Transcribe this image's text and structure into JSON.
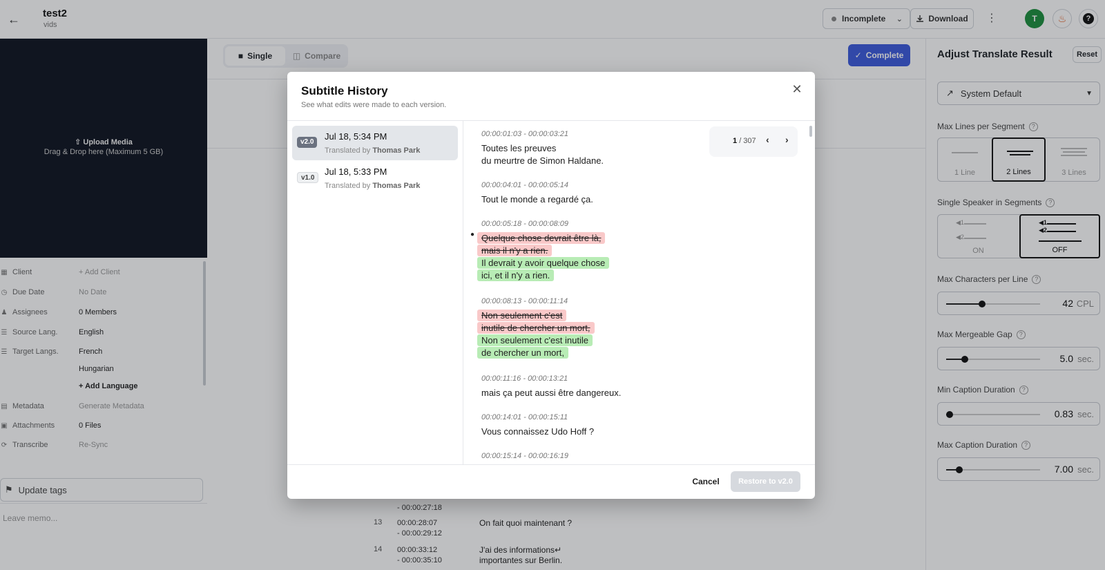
{
  "header": {
    "title": "test2",
    "subtitle": "vids",
    "status_label": "Incomplete",
    "download_label": "Download",
    "avatar_initial": "T"
  },
  "left": {
    "upload_title": "Upload Media",
    "upload_hint": "Drag & Drop here (Maximum 5 GB)",
    "info": [
      {
        "key": "Client",
        "value": "Add Client"
      },
      {
        "key": "Due Date",
        "value": "No Date"
      },
      {
        "key": "Assignees",
        "value": "0 Members"
      },
      {
        "key": "Source Lang.",
        "value": "English"
      },
      {
        "key": "Target Langs.",
        "value": "French"
      },
      {
        "key": "",
        "value": "Hungarian"
      },
      {
        "key": "",
        "value": "+ Add Language"
      },
      {
        "key": "Metadata",
        "value": "Generate Metadata"
      },
      {
        "key": "Attachments",
        "value": "0 Files"
      },
      {
        "key": "Transcribe",
        "value": "Re-Sync"
      }
    ],
    "tags_placeholder": "Update tags",
    "memo_placeholder": "Leave memo..."
  },
  "center": {
    "mode_single": "Single",
    "mode_compare": "Compare",
    "complete_label": "Complete",
    "rows": [
      {
        "num": "",
        "time_start": "",
        "time_end": "- 00:00:27:18",
        "text1": "",
        "text2": ""
      },
      {
        "num": "13",
        "time_start": "00:00:28:07",
        "time_end": "- 00:00:29:12",
        "text1": "On fait quoi maintenant ?",
        "text2": ""
      },
      {
        "num": "14",
        "time_start": "00:00:33:12",
        "time_end": "- 00:00:35:10",
        "text1": "J'ai des informations↵",
        "text2": "importantes sur Berlin."
      }
    ]
  },
  "right": {
    "title": "Adjust Translate Result",
    "reset_label": "Reset",
    "preset": "System Default",
    "max_lines_label": "Max Lines per Segment",
    "lines_options": [
      "1 Line",
      "2 Lines",
      "3 Lines"
    ],
    "lines_selected": 1,
    "speaker_label": "Single Speaker in Segments",
    "speaker_options": [
      "ON",
      "OFF"
    ],
    "speaker_selected": 1,
    "sliders": [
      {
        "label": "Max Characters per Line",
        "value": "42",
        "unit": "CPL",
        "fraction": 0.38
      },
      {
        "label": "Max Mergeable Gap",
        "value": "5.0",
        "unit": "sec.",
        "fraction": 0.2
      },
      {
        "label": "Min Caption Duration",
        "value": "0.83",
        "unit": "sec.",
        "fraction": 0.04
      },
      {
        "label": "Max Caption Duration",
        "value": "7.00",
        "unit": "sec.",
        "fraction": 0.14
      }
    ]
  },
  "modal": {
    "title": "Subtitle History",
    "subtitle": "See what edits were made to each version.",
    "versions": [
      {
        "badge": "v2.0",
        "date": "Jul 18, 5:34 PM",
        "by_prefix": "Translated by",
        "by_name": "Thomas Park"
      },
      {
        "badge": "v1.0",
        "date": "Jul 18, 5:33 PM",
        "by_prefix": "Translated by",
        "by_name": "Thomas Park"
      }
    ],
    "pager": {
      "current": "1",
      "total": "/ 307"
    },
    "cues": [
      {
        "time": "00:00:01:03 - 00:00:03:21",
        "line1": "Toutes les preuves",
        "line2": "du meurtre de Simon Haldane."
      },
      {
        "time": "00:00:04:01 - 00:00:05:14",
        "line1": "Tout le monde a regardé ça."
      },
      {
        "time": "00:00:05:18 - 00:00:08:09",
        "del1": "Quelque chose devrait être là,",
        "del2": "mais il n'y a rien.",
        "ins1": "Il devrait y avoir quelque chose",
        "ins2": "ici, et il n'y a rien."
      },
      {
        "time": "00:00:08:13 - 00:00:11:14",
        "del1": "Non seulement c'est",
        "del2": "inutile de chercher un mort,",
        "ins1": "Non seulement c'est inutile",
        "ins2": "de chercher un mort,"
      },
      {
        "time": "00:00:11:16 - 00:00:13:21",
        "line1": "mais ça peut aussi être dangereux."
      },
      {
        "time": "00:00:14:01 - 00:00:15:11",
        "line1": "Vous connaissez Udo Hoff ?"
      },
      {
        "time": "00:00:15:14 - 00:00:16:19"
      }
    ],
    "cancel_label": "Cancel",
    "restore_label": "Restore to v2.0"
  }
}
